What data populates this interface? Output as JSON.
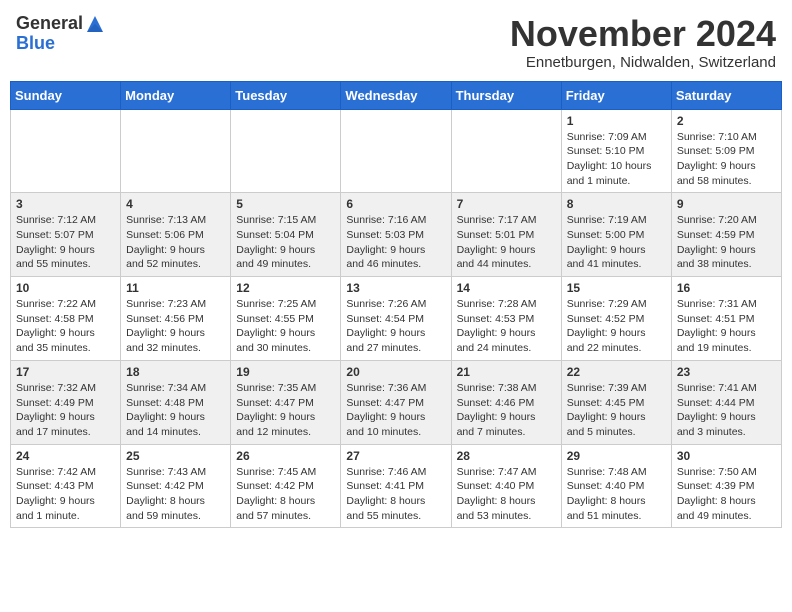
{
  "header": {
    "logo_general": "General",
    "logo_blue": "Blue",
    "month_title": "November 2024",
    "subtitle": "Ennetburgen, Nidwalden, Switzerland"
  },
  "calendar": {
    "headers": [
      "Sunday",
      "Monday",
      "Tuesday",
      "Wednesday",
      "Thursday",
      "Friday",
      "Saturday"
    ],
    "weeks": [
      [
        {
          "day": "",
          "content": ""
        },
        {
          "day": "",
          "content": ""
        },
        {
          "day": "",
          "content": ""
        },
        {
          "day": "",
          "content": ""
        },
        {
          "day": "",
          "content": ""
        },
        {
          "day": "1",
          "content": "Sunrise: 7:09 AM\nSunset: 5:10 PM\nDaylight: 10 hours and 1 minute."
        },
        {
          "day": "2",
          "content": "Sunrise: 7:10 AM\nSunset: 5:09 PM\nDaylight: 9 hours and 58 minutes."
        }
      ],
      [
        {
          "day": "3",
          "content": "Sunrise: 7:12 AM\nSunset: 5:07 PM\nDaylight: 9 hours and 55 minutes."
        },
        {
          "day": "4",
          "content": "Sunrise: 7:13 AM\nSunset: 5:06 PM\nDaylight: 9 hours and 52 minutes."
        },
        {
          "day": "5",
          "content": "Sunrise: 7:15 AM\nSunset: 5:04 PM\nDaylight: 9 hours and 49 minutes."
        },
        {
          "day": "6",
          "content": "Sunrise: 7:16 AM\nSunset: 5:03 PM\nDaylight: 9 hours and 46 minutes."
        },
        {
          "day": "7",
          "content": "Sunrise: 7:17 AM\nSunset: 5:01 PM\nDaylight: 9 hours and 44 minutes."
        },
        {
          "day": "8",
          "content": "Sunrise: 7:19 AM\nSunset: 5:00 PM\nDaylight: 9 hours and 41 minutes."
        },
        {
          "day": "9",
          "content": "Sunrise: 7:20 AM\nSunset: 4:59 PM\nDaylight: 9 hours and 38 minutes."
        }
      ],
      [
        {
          "day": "10",
          "content": "Sunrise: 7:22 AM\nSunset: 4:58 PM\nDaylight: 9 hours and 35 minutes."
        },
        {
          "day": "11",
          "content": "Sunrise: 7:23 AM\nSunset: 4:56 PM\nDaylight: 9 hours and 32 minutes."
        },
        {
          "day": "12",
          "content": "Sunrise: 7:25 AM\nSunset: 4:55 PM\nDaylight: 9 hours and 30 minutes."
        },
        {
          "day": "13",
          "content": "Sunrise: 7:26 AM\nSunset: 4:54 PM\nDaylight: 9 hours and 27 minutes."
        },
        {
          "day": "14",
          "content": "Sunrise: 7:28 AM\nSunset: 4:53 PM\nDaylight: 9 hours and 24 minutes."
        },
        {
          "day": "15",
          "content": "Sunrise: 7:29 AM\nSunset: 4:52 PM\nDaylight: 9 hours and 22 minutes."
        },
        {
          "day": "16",
          "content": "Sunrise: 7:31 AM\nSunset: 4:51 PM\nDaylight: 9 hours and 19 minutes."
        }
      ],
      [
        {
          "day": "17",
          "content": "Sunrise: 7:32 AM\nSunset: 4:49 PM\nDaylight: 9 hours and 17 minutes."
        },
        {
          "day": "18",
          "content": "Sunrise: 7:34 AM\nSunset: 4:48 PM\nDaylight: 9 hours and 14 minutes."
        },
        {
          "day": "19",
          "content": "Sunrise: 7:35 AM\nSunset: 4:47 PM\nDaylight: 9 hours and 12 minutes."
        },
        {
          "day": "20",
          "content": "Sunrise: 7:36 AM\nSunset: 4:47 PM\nDaylight: 9 hours and 10 minutes."
        },
        {
          "day": "21",
          "content": "Sunrise: 7:38 AM\nSunset: 4:46 PM\nDaylight: 9 hours and 7 minutes."
        },
        {
          "day": "22",
          "content": "Sunrise: 7:39 AM\nSunset: 4:45 PM\nDaylight: 9 hours and 5 minutes."
        },
        {
          "day": "23",
          "content": "Sunrise: 7:41 AM\nSunset: 4:44 PM\nDaylight: 9 hours and 3 minutes."
        }
      ],
      [
        {
          "day": "24",
          "content": "Sunrise: 7:42 AM\nSunset: 4:43 PM\nDaylight: 9 hours and 1 minute."
        },
        {
          "day": "25",
          "content": "Sunrise: 7:43 AM\nSunset: 4:42 PM\nDaylight: 8 hours and 59 minutes."
        },
        {
          "day": "26",
          "content": "Sunrise: 7:45 AM\nSunset: 4:42 PM\nDaylight: 8 hours and 57 minutes."
        },
        {
          "day": "27",
          "content": "Sunrise: 7:46 AM\nSunset: 4:41 PM\nDaylight: 8 hours and 55 minutes."
        },
        {
          "day": "28",
          "content": "Sunrise: 7:47 AM\nSunset: 4:40 PM\nDaylight: 8 hours and 53 minutes."
        },
        {
          "day": "29",
          "content": "Sunrise: 7:48 AM\nSunset: 4:40 PM\nDaylight: 8 hours and 51 minutes."
        },
        {
          "day": "30",
          "content": "Sunrise: 7:50 AM\nSunset: 4:39 PM\nDaylight: 8 hours and 49 minutes."
        }
      ]
    ]
  }
}
